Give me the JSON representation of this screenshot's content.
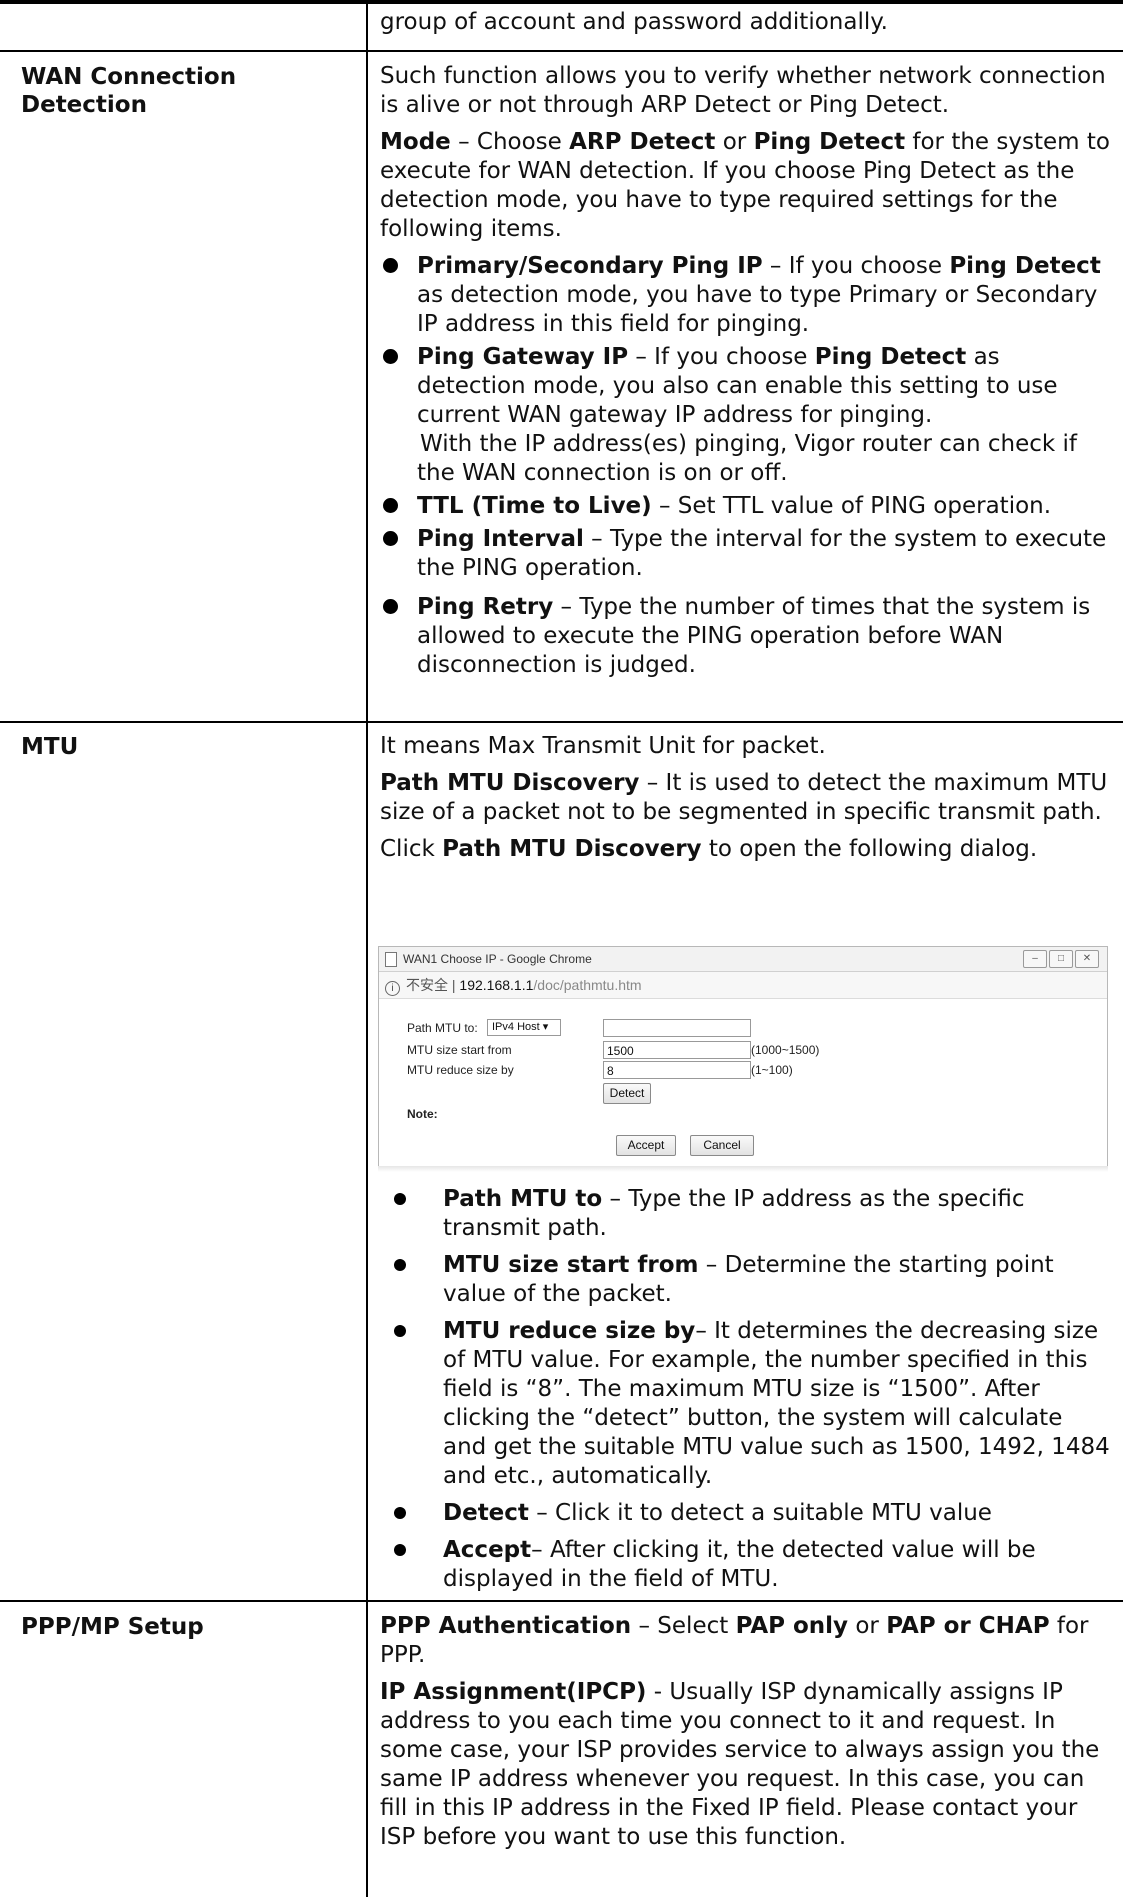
{
  "rows": {
    "top": {
      "text": "group of account and password additionally."
    },
    "wan": {
      "label": "WAN Connection Detection",
      "intro": "Such function allows you to verify whether network connection is alive or not through ARP Detect or Ping Detect.",
      "mode_term": "Mode",
      "mode_pre": " – Choose ",
      "mode_arp": "ARP Detect",
      "mode_or": " or ",
      "mode_ping": "Ping Detect",
      "mode_rest": " for the system to execute for WAN detection. If you choose Ping Detect as the detection mode, you have to type required settings for the following items.",
      "b1_term": "Primary/Secondary Ping IP",
      "b1_pre": " – If you choose ",
      "b1_bold": "Ping Detect",
      "b1_rest": " as detection mode, you have to type Primary or Secondary IP address in this field for pinging.",
      "b2_term": "Ping Gateway IP",
      "b2_pre": " – If you choose ",
      "b2_bold": "Ping Detect",
      "b2_rest": " as detection mode, you also can enable this setting to use current WAN gateway IP address for pinging.",
      "b2_extra": "With the IP address(es) pinging, Vigor router can check if the WAN connection is on or off.",
      "b3_term": "TTL (Time to Live)",
      "b3_rest": " – Set TTL value of PING operation.",
      "b4_term": "Ping Interval",
      "b4_rest": " – Type the interval for the system to execute the PING operation.",
      "b5_term": "Ping Retry",
      "b5_rest": " – Type the number of times that the system is allowed to execute the PING operation before WAN disconnection is judged."
    },
    "mtu": {
      "label": "MTU",
      "intro": "It means Max Transmit Unit for packet.",
      "pmd_term": "Path MTU Discovery",
      "pmd_rest": " – It is used to detect the maximum MTU size of a packet not to be segmented in specific transmit path.",
      "click_pre": "Click ",
      "click_bold": "Path MTU Discovery",
      "click_rest": " to open the following dialog.",
      "dialog": {
        "title": "WAN1 Choose IP - Google Chrome",
        "btn_min": "–",
        "btn_max": "□",
        "btn_close": "✕",
        "info": "i",
        "addr_prefix": "不安全",
        "addr_sep": "|",
        "addr_host": "192.168.1.1",
        "addr_path": "/doc/pathmtu.htm",
        "path_label": "Path MTU to:",
        "path_select": "IPv4 Host ▾",
        "path_value": "",
        "start_label": "MTU size start from",
        "start_value": "1500",
        "start_range": "(1000~1500)",
        "reduce_label": "MTU reduce size by",
        "reduce_value": "8",
        "reduce_range": "(1~100)",
        "detect": "Detect",
        "note": "Note:",
        "accept": "Accept",
        "cancel": "Cancel"
      },
      "d1_term": "Path MTU to",
      "d1_rest": " – Type the IP address as the specific transmit path.",
      "d2_term": "MTU size start from",
      "d2_rest": " – Determine the starting point value of the packet.",
      "d3_term": "MTU reduce size by",
      "d3_rest": "– It determines the decreasing size of MTU value. For example, the number specified in this field is “8”. The maximum MTU size is “1500”. After clicking the “detect” button, the system will calculate and get the suitable MTU value such as 1500, 1492, 1484 and etc., automatically.",
      "d4_term": "Detect",
      "d4_rest": " – Click it to detect a suitable MTU value",
      "d5_term": "Accept",
      "d5_rest": "– After clicking it, the detected value will be displayed in the field of MTU."
    },
    "ppp": {
      "label": "PPP/MP Setup",
      "auth_term": "PPP Authentication",
      "auth_pre": " – Select ",
      "auth_b1": "PAP only",
      "auth_or": " or ",
      "auth_b2": "PAP or CHAP",
      "auth_rest": " for PPP.",
      "ip_term": "IP Assignment(IPCP)",
      "ip_rest": " - Usually ISP dynamically assigns IP address to you each time you connect to it and request. In some case, your ISP provides service to always assign you the same IP address whenever you request. In this case, you can fill in this IP address in the Fixed IP field. Please contact your ISP before you want to use this function."
    }
  }
}
